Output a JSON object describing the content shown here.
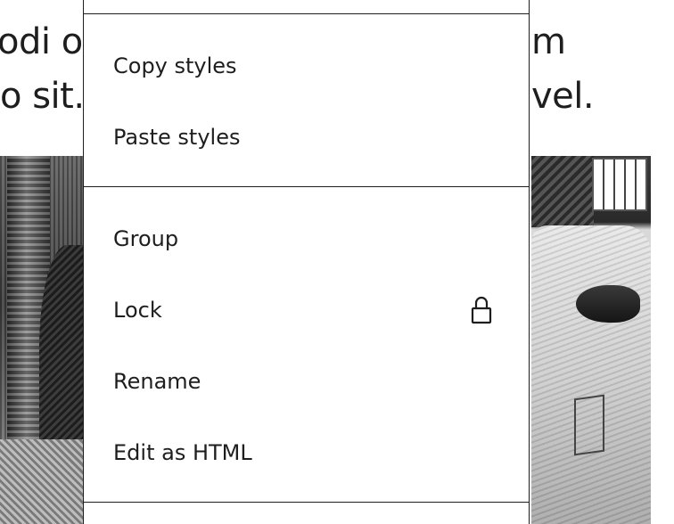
{
  "background": {
    "text_line_1_left": "odi o",
    "text_line_1_right": "m",
    "text_line_2_left": "o sit.",
    "text_line_2_right": "vel."
  },
  "menu": {
    "groups": [
      {
        "items": [
          {
            "label": "Copy styles"
          },
          {
            "label": "Paste styles"
          }
        ]
      },
      {
        "items": [
          {
            "label": "Group"
          },
          {
            "label": "Lock",
            "icon": "lock-icon"
          },
          {
            "label": "Rename"
          },
          {
            "label": "Edit as HTML"
          }
        ]
      }
    ]
  },
  "colors": {
    "text": "#1e1e1e",
    "border": "#1e1e1e",
    "menu_background": "#ffffff"
  }
}
